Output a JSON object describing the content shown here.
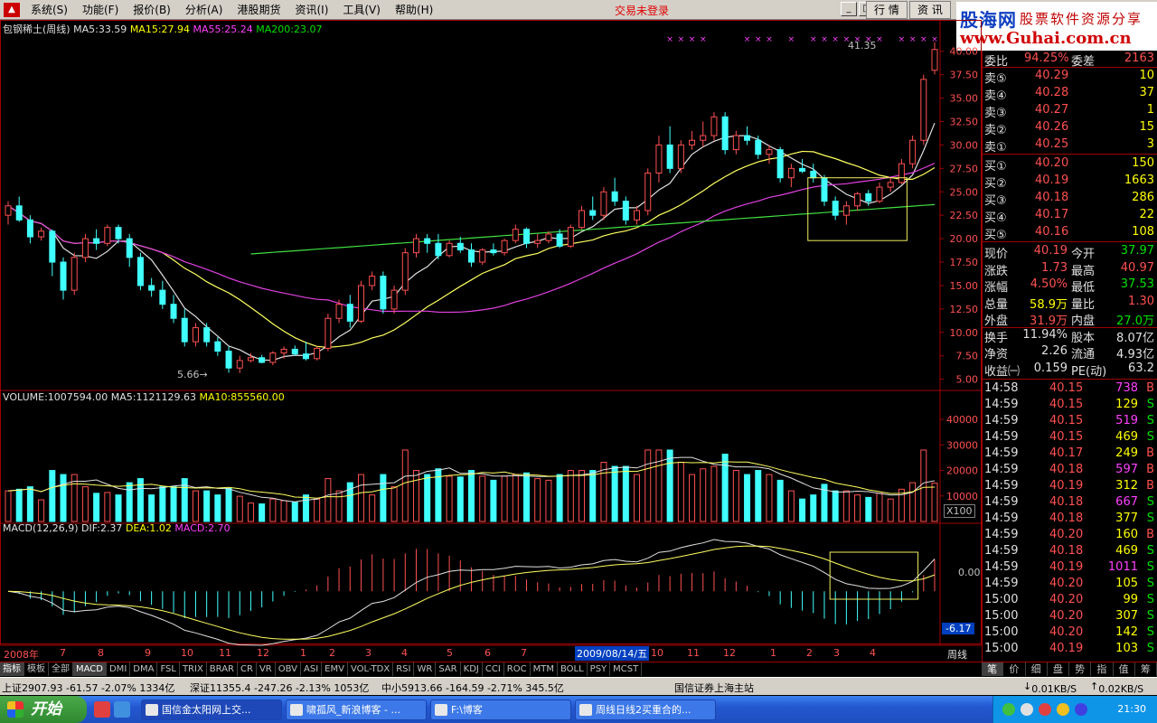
{
  "menu": {
    "items": [
      "系统(S)",
      "功能(F)",
      "报价(B)",
      "分析(A)",
      "港股期货",
      "资讯(I)",
      "工具(V)",
      "帮助(H)"
    ],
    "trade_status": "交易未登录",
    "tab_market": "行 情",
    "tab_news": "资 讯"
  },
  "brand": {
    "name": "股海网",
    "slogan": "股票软件资源分享",
    "url": "www.Guhai.com.cn"
  },
  "main_panel": {
    "title": "包钢稀土(周线)",
    "ma5": "MA5:33.59",
    "ma15": "MA15:27.94",
    "ma55": "MA55:25.24",
    "ma200": "MA200:23.07",
    "high_label": "41.35",
    "low_label": "5.66",
    "yaxis": [
      "40.00",
      "37.50",
      "35.00",
      "32.50",
      "30.00",
      "27.50",
      "25.00",
      "22.50",
      "20.00",
      "17.50",
      "15.00",
      "12.50",
      "10.00",
      "7.50",
      "5.00"
    ]
  },
  "volume_panel": {
    "title": "VOLUME:1007594.00",
    "ma5": "MA5:1121129.63",
    "ma10": "MA10:855560.00",
    "yaxis": [
      "40000",
      "30000",
      "20000",
      "10000"
    ],
    "unit": "X100"
  },
  "macd_panel": {
    "title": "MACD(12,26,9)",
    "dif": "DIF:2.37",
    "dea": "DEA:1.02",
    "macd": "MACD:2.70",
    "zero": "0.00",
    "min": "-6.17"
  },
  "time_axis": {
    "labels": [
      "2008年",
      "7",
      "8",
      "9",
      "10",
      "11",
      "12",
      "1",
      "2",
      "3",
      "4",
      "5",
      "6",
      "7",
      "2009/08/14/五",
      "10",
      "11",
      "12",
      "1",
      "2",
      "3",
      "4"
    ],
    "period": "周线"
  },
  "quote": {
    "weibi_label": "委比",
    "weibi": "94.25%",
    "weicha_label": "委差",
    "weicha": "2163",
    "asks": [
      {
        "label": "卖⑤",
        "price": "40.29",
        "vol": "10"
      },
      {
        "label": "卖④",
        "price": "40.28",
        "vol": "37"
      },
      {
        "label": "卖③",
        "price": "40.27",
        "vol": "1"
      },
      {
        "label": "卖②",
        "price": "40.26",
        "vol": "15"
      },
      {
        "label": "卖①",
        "price": "40.25",
        "vol": "3"
      }
    ],
    "bids": [
      {
        "label": "买①",
        "price": "40.20",
        "vol": "150"
      },
      {
        "label": "买②",
        "price": "40.19",
        "vol": "1663"
      },
      {
        "label": "买③",
        "price": "40.18",
        "vol": "286"
      },
      {
        "label": "买④",
        "price": "40.17",
        "vol": "22"
      },
      {
        "label": "买⑤",
        "price": "40.16",
        "vol": "108"
      }
    ],
    "stats": [
      {
        "l1": "现价",
        "v1": "40.19",
        "l2": "今开",
        "v2": "37.97"
      },
      {
        "l1": "涨跌",
        "v1": "1.73",
        "l2": "最高",
        "v2": "40.97"
      },
      {
        "l1": "涨幅",
        "v1": "4.50%",
        "l2": "最低",
        "v2": "37.53"
      },
      {
        "l1": "总量",
        "v1": "58.9万",
        "l2": "量比",
        "v2": "1.30"
      },
      {
        "l1": "外盘",
        "v1": "31.9万",
        "l2": "内盘",
        "v2": "27.0万"
      },
      {
        "l1": "换手",
        "v1": "11.94%",
        "l2": "股本",
        "v2": "8.07亿"
      },
      {
        "l1": "净资",
        "v1": "2.26",
        "l2": "流通",
        "v2": "4.93亿"
      },
      {
        "l1": "收益㈠",
        "v1": "0.159",
        "l2": "PE(动)",
        "v2": "63.2"
      }
    ],
    "ticks": [
      {
        "time": "14:58",
        "price": "40.15",
        "vol": "738",
        "side": "B"
      },
      {
        "time": "14:59",
        "price": "40.15",
        "vol": "129",
        "side": "S"
      },
      {
        "time": "14:59",
        "price": "40.15",
        "vol": "519",
        "side": "S"
      },
      {
        "time": "14:59",
        "price": "40.15",
        "vol": "469",
        "side": "S"
      },
      {
        "time": "14:59",
        "price": "40.17",
        "vol": "249",
        "side": "B"
      },
      {
        "time": "14:59",
        "price": "40.18",
        "vol": "597",
        "side": "B"
      },
      {
        "time": "14:59",
        "price": "40.19",
        "vol": "312",
        "side": "B"
      },
      {
        "time": "14:59",
        "price": "40.18",
        "vol": "667",
        "side": "S"
      },
      {
        "time": "14:59",
        "price": "40.18",
        "vol": "377",
        "side": "S"
      },
      {
        "time": "14:59",
        "price": "40.20",
        "vol": "160",
        "side": "B"
      },
      {
        "time": "14:59",
        "price": "40.18",
        "vol": "469",
        "side": "S"
      },
      {
        "time": "14:59",
        "price": "40.19",
        "vol": "1011",
        "side": "S"
      },
      {
        "time": "14:59",
        "price": "40.20",
        "vol": "105",
        "side": "S"
      },
      {
        "time": "15:00",
        "price": "40.20",
        "vol": "99",
        "side": "S"
      },
      {
        "time": "15:00",
        "price": "40.20",
        "vol": "307",
        "side": "S"
      },
      {
        "time": "15:00",
        "price": "40.20",
        "vol": "142",
        "side": "S"
      },
      {
        "time": "15:00",
        "price": "40.19",
        "vol": "103",
        "side": "S"
      }
    ]
  },
  "indicator_tabs": [
    "指标",
    "模板",
    "全部",
    "MACD",
    "DMI",
    "DMA",
    "FSL",
    "TRIX",
    "BRAR",
    "CR",
    "VR",
    "OBV",
    "ASI",
    "EMV",
    "VOL-TDX",
    "RSI",
    "WR",
    "SAR",
    "KDJ",
    "CCI",
    "ROC",
    "MTM",
    "BOLL",
    "PSY",
    "MCST"
  ],
  "quote_tabs": [
    "笔",
    "价",
    "细",
    "盘",
    "势",
    "指",
    "值",
    "筹"
  ],
  "status": {
    "sh": "上证2907.93  -61.57  -2.07%  1334亿",
    "sz": "深证11355.4  -247.26  -2.13%  1053亿",
    "zx": "中小5913.66  -164.59  -2.71%  345.5亿",
    "server": "国信证券上海主站",
    "net_down": "0.01KB/S",
    "net_up": "0.02KB/S"
  },
  "taskbar": {
    "start": "开始",
    "tasks": [
      "国信金太阳网上交...",
      "啸孤风_新浪博客 - ...",
      "F:\\博客",
      "周线日线2买重合的..."
    ],
    "time": "21:30"
  },
  "colors": {
    "up": "#ff5050",
    "down": "#40ffff",
    "ma5": "#e0e0e0",
    "ma15": "#ffff60",
    "ma55": "#e040e0",
    "ma200": "#40e040"
  },
  "chart_data": {
    "type": "candlestick",
    "title": "包钢稀土(周线)",
    "ylim": [
      4,
      42
    ],
    "candles": [
      [
        22.5,
        24.0,
        21.5,
        23.5
      ],
      [
        23.5,
        24.5,
        21.8,
        22.0
      ],
      [
        22.0,
        22.5,
        19.5,
        20.2
      ],
      [
        20.2,
        21.2,
        19.8,
        20.8
      ],
      [
        20.8,
        21.0,
        16.0,
        17.5
      ],
      [
        17.5,
        18.0,
        13.5,
        14.5
      ],
      [
        14.5,
        18.5,
        14.0,
        18.0
      ],
      [
        18.0,
        20.5,
        17.5,
        20.0
      ],
      [
        20.0,
        21.0,
        18.8,
        19.5
      ],
      [
        19.5,
        21.5,
        19.2,
        21.2
      ],
      [
        21.2,
        21.5,
        19.5,
        20.0
      ],
      [
        20.0,
        20.5,
        17.0,
        18.0
      ],
      [
        18.0,
        18.5,
        14.5,
        15.0
      ],
      [
        15.0,
        15.8,
        13.8,
        14.5
      ],
      [
        14.5,
        15.5,
        12.5,
        13.0
      ],
      [
        13.0,
        14.0,
        11.0,
        11.5
      ],
      [
        11.5,
        12.5,
        8.5,
        9.0
      ],
      [
        9.0,
        11.0,
        8.5,
        10.5
      ],
      [
        10.5,
        11.0,
        8.5,
        9.0
      ],
      [
        9.0,
        9.5,
        7.5,
        8.0
      ],
      [
        8.0,
        8.5,
        5.7,
        6.2
      ],
      [
        6.2,
        7.5,
        5.66,
        7.0
      ],
      [
        7.0,
        7.8,
        6.8,
        7.3
      ],
      [
        7.3,
        7.6,
        6.7,
        6.8
      ],
      [
        6.8,
        8.0,
        6.5,
        7.8
      ],
      [
        7.8,
        8.5,
        7.2,
        8.2
      ],
      [
        8.2,
        8.6,
        7.5,
        7.7
      ],
      [
        7.7,
        9.0,
        7.0,
        7.2
      ],
      [
        7.2,
        8.5,
        7.0,
        8.3
      ],
      [
        8.3,
        12.0,
        8.0,
        11.5
      ],
      [
        11.5,
        13.5,
        11.0,
        13.0
      ],
      [
        13.0,
        14.0,
        10.5,
        11.2
      ],
      [
        11.2,
        15.5,
        11.0,
        15.0
      ],
      [
        15.0,
        16.5,
        14.5,
        16.0
      ],
      [
        16.0,
        16.5,
        12.0,
        12.5
      ],
      [
        12.5,
        15.0,
        12.0,
        14.5
      ],
      [
        14.5,
        19.0,
        14.0,
        18.5
      ],
      [
        18.5,
        20.5,
        18.0,
        20.0
      ],
      [
        20.0,
        20.5,
        18.5,
        19.5
      ],
      [
        19.5,
        20.5,
        17.8,
        18.2
      ],
      [
        18.2,
        19.8,
        18.0,
        19.5
      ],
      [
        19.5,
        20.2,
        18.5,
        18.8
      ],
      [
        18.8,
        19.5,
        17.0,
        17.5
      ],
      [
        17.5,
        19.0,
        17.2,
        18.8
      ],
      [
        18.8,
        19.5,
        18.2,
        18.5
      ],
      [
        18.5,
        20.0,
        18.2,
        19.8
      ],
      [
        19.8,
        21.5,
        19.5,
        21.0
      ],
      [
        21.0,
        21.2,
        19.0,
        19.5
      ],
      [
        19.5,
        20.5,
        19.0,
        19.8
      ],
      [
        19.8,
        20.8,
        19.5,
        20.5
      ],
      [
        20.5,
        21.0,
        19.0,
        19.2
      ],
      [
        19.2,
        21.5,
        19.0,
        21.2
      ],
      [
        21.2,
        23.5,
        21.0,
        23.0
      ],
      [
        23.0,
        24.5,
        22.0,
        22.5
      ],
      [
        22.5,
        25.5,
        22.0,
        25.0
      ],
      [
        25.0,
        26.5,
        23.5,
        24.0
      ],
      [
        24.0,
        24.5,
        21.5,
        22.0
      ],
      [
        22.0,
        23.5,
        21.5,
        23.0
      ],
      [
        23.0,
        27.5,
        22.5,
        27.0
      ],
      [
        27.0,
        31.0,
        26.0,
        30.0
      ],
      [
        30.0,
        32.0,
        27.0,
        27.5
      ],
      [
        27.5,
        30.5,
        27.0,
        30.0
      ],
      [
        30.0,
        31.5,
        29.5,
        30.5
      ],
      [
        30.5,
        32.5,
        29.8,
        31.0
      ],
      [
        31.0,
        33.5,
        30.5,
        33.0
      ],
      [
        33.0,
        33.5,
        29.0,
        29.5
      ],
      [
        29.5,
        31.5,
        29.0,
        31.0
      ],
      [
        31.0,
        32.0,
        30.0,
        30.5
      ],
      [
        30.5,
        31.0,
        28.5,
        29.0
      ],
      [
        29.0,
        30.0,
        28.0,
        29.5
      ],
      [
        29.5,
        29.8,
        26.0,
        26.5
      ],
      [
        26.5,
        28.0,
        25.5,
        27.5
      ],
      [
        27.5,
        28.5,
        27.0,
        27.2
      ],
      [
        27.2,
        28.0,
        26.0,
        26.5
      ],
      [
        26.5,
        26.8,
        23.5,
        24.0
      ],
      [
        24.0,
        24.5,
        22.0,
        22.5
      ],
      [
        22.5,
        24.0,
        21.5,
        23.5
      ],
      [
        23.5,
        25.0,
        23.0,
        24.8
      ],
      [
        24.8,
        25.2,
        23.5,
        24.0
      ],
      [
        24.0,
        26.0,
        23.8,
        25.5
      ],
      [
        25.5,
        26.5,
        25.0,
        26.0
      ],
      [
        26.0,
        28.5,
        25.8,
        28.0
      ],
      [
        28.0,
        31.0,
        27.5,
        30.5
      ],
      [
        30.5,
        37.5,
        30.0,
        37.0
      ],
      [
        37.97,
        40.97,
        37.53,
        40.19
      ]
    ]
  }
}
